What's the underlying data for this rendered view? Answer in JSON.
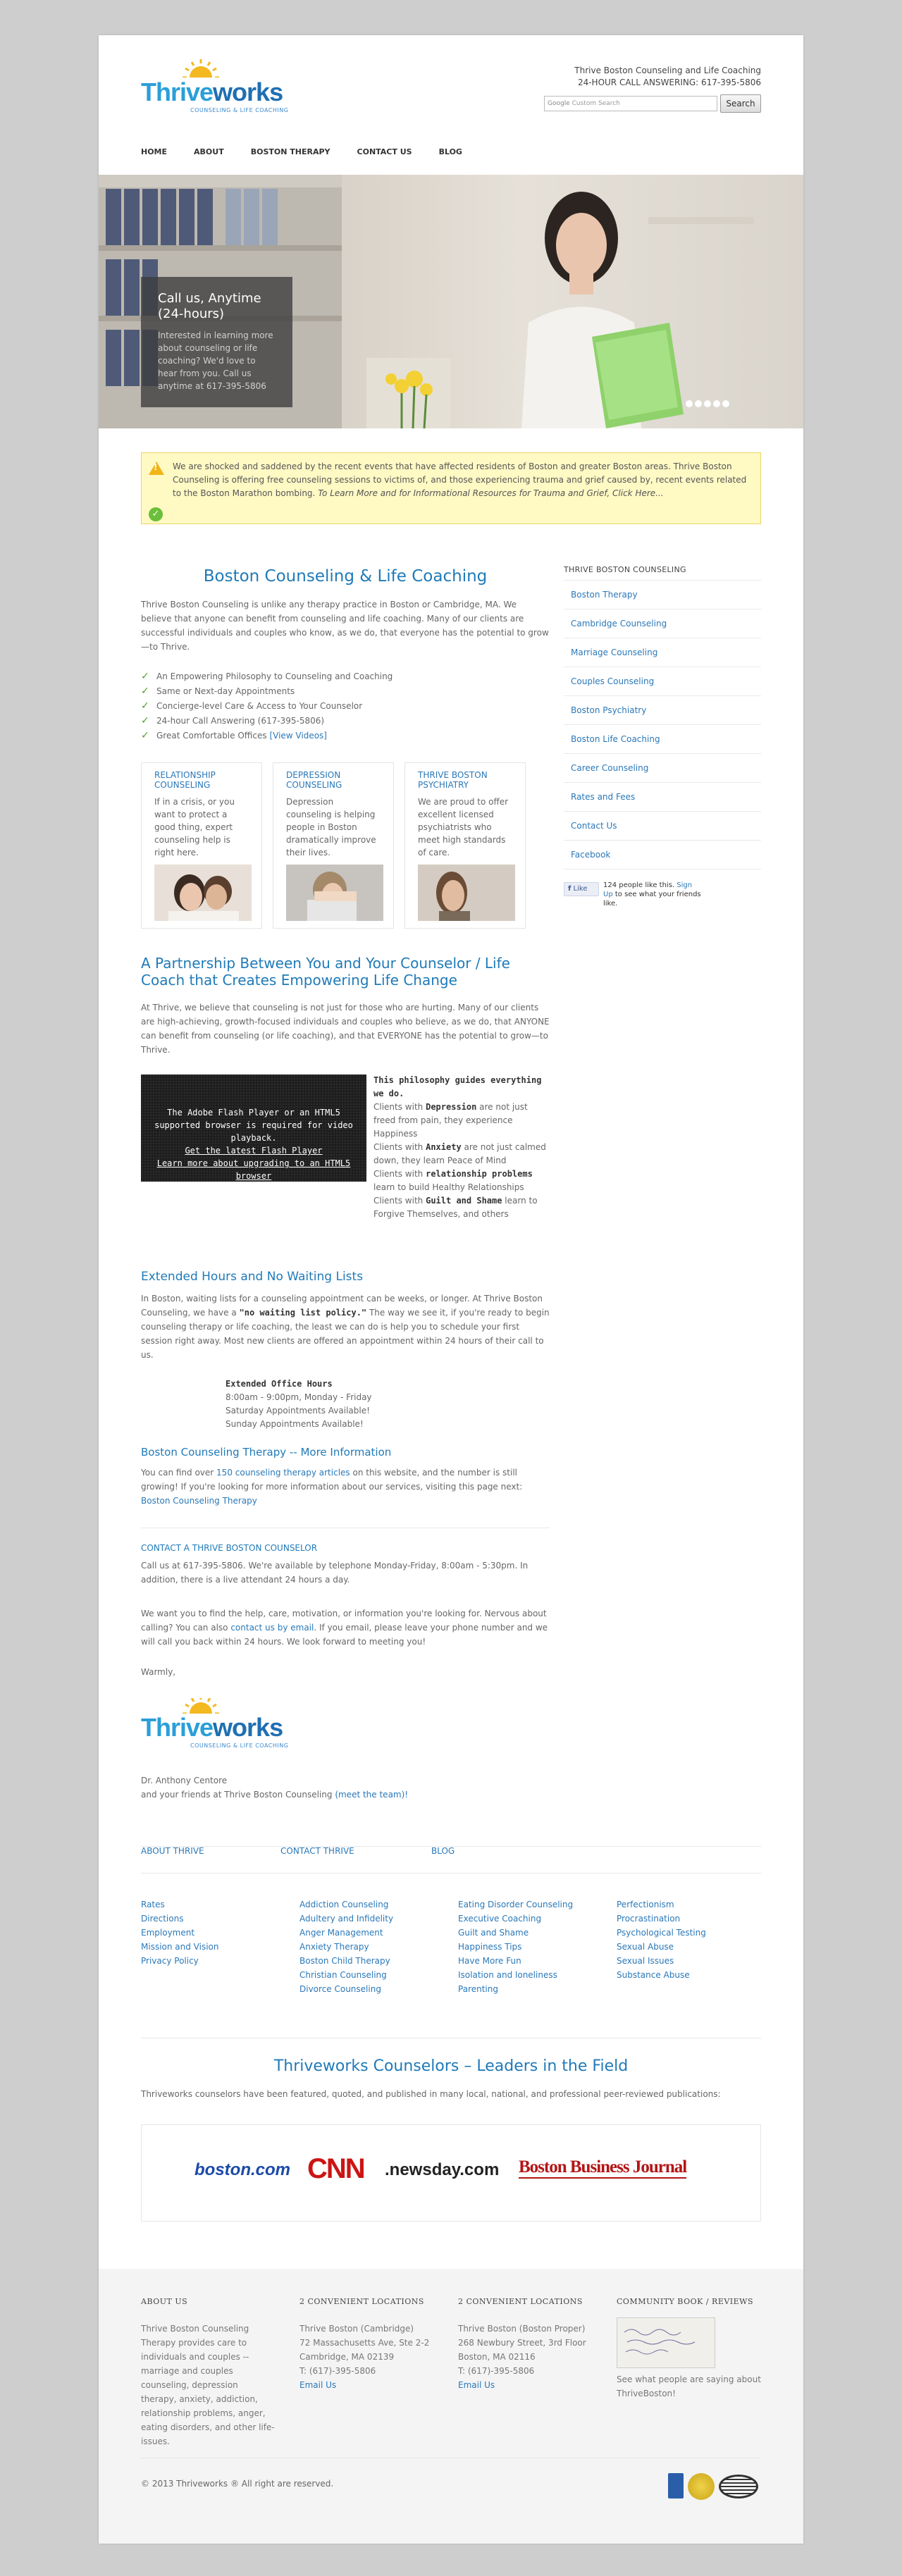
{
  "header": {
    "logo_main": "Thriveworks",
    "logo_tagline": "COUNSELING & LIFE COACHING",
    "contact_line1": "Thrive Boston Counseling and Life Coaching",
    "contact_line2": "24-HOUR CALL ANSWERING: 617-395-5806",
    "search_placeholder": "Custom Search",
    "search_brand": "Google",
    "search_button": "Search"
  },
  "nav": [
    "HOME",
    "ABOUT",
    "BOSTON THERAPY",
    "CONTACT US",
    "BLOG"
  ],
  "hero": {
    "title": "Call us, Anytime (24-hours)",
    "text": "Interested in learning more about counseling or life coaching? We'd love to hear from you. Call us anytime at 617-395-5806",
    "slides": 5
  },
  "alert": {
    "text": "We are shocked and saddened by the recent events that have affected residents of Boston and greater Boston areas. Thrive Boston Counseling is offering free counseling sessions to victims of, and those experiencing trauma and grief caused by, recent events related to the Boston Marathon bombing.",
    "link": "To Learn More and for Informational Resources for Trauma and Grief, Click Here..."
  },
  "main": {
    "title": "Boston Counseling & Life Coaching",
    "intro": "Thrive Boston Counseling is unlike any therapy practice in Boston or Cambridge, MA. We believe that anyone can benefit from counseling and life coaching. Many of our clients are successful individuals and couples who know, as we do, that everyone has the potential to grow—to Thrive.",
    "checks": [
      "An Empowering Philosophy to Counseling and Coaching",
      "Same or Next-day Appointments",
      "Concierge-level Care & Access to Your Counselor",
      "24-hour Call Answering (617-395-5806)",
      "Great Comfortable Offices"
    ],
    "checks_link": "[View Videos]",
    "services": [
      {
        "title": "RELATIONSHIP COUNSELING",
        "text": "If in a crisis, or you want to protect a good thing, expert counseling help is right here."
      },
      {
        "title": "DEPRESSION COUNSELING",
        "text": "Depression counseling is helping people in Boston dramatically improve their lives."
      },
      {
        "title": "THRIVE BOSTON PSYCHIATRY",
        "text": "We are proud to offer excellent licensed psychiatrists who meet high standards of care."
      }
    ],
    "partnership_title": "A Partnership Between You and Your Counselor / Life Coach that Creates Empowering Life Change",
    "partnership_text": "At Thrive, we believe that counseling is not just for those who are hurting. Many of our clients are high-achieving, growth-focused individuals and couples who believe, as we do, that ANYONE can benefit from counseling (or life coaching), and that EVERYONE has the potential to grow—to Thrive.",
    "flash_line1": "The Adobe Flash Player or an HTML5 supported browser is required for video playback.",
    "flash_link1": "Get the latest Flash Player",
    "flash_link2": "Learn more about upgrading to an HTML5 browser",
    "philosophy_head": "This philosophy guides everything we do.",
    "phil": [
      {
        "a": "Clients with ",
        "b": "Depression",
        "c": " are not just freed from pain, they experience Happiness"
      },
      {
        "a": "Clients with ",
        "b": "Anxiety",
        "c": " are not just calmed down, they learn Peace of Mind"
      },
      {
        "a": "Clients with ",
        "b": "relationship problems",
        "c": " learn to build Healthy Relationships"
      },
      {
        "a": "Clients with ",
        "b": "Guilt and Shame",
        "c": " learn to Forgive Themselves, and others"
      }
    ],
    "hours_title": "Extended Hours and No Waiting Lists",
    "hours_text_a": "In Boston, waiting lists for a counseling appointment can be weeks, or longer. At Thrive Boston Counseling, we have a ",
    "hours_text_b": "\"no waiting list policy.\"",
    "hours_text_c": " The way we see it, if you're ready to begin counseling therapy or life coaching, the least we can do is help you to schedule your first session right away. Most new clients are offered an appointment within 24 hours of their call to us.",
    "office_hours_head": "Extended Office Hours",
    "office_hours": [
      "8:00am - 9:00pm, Monday - Friday",
      "Saturday Appointments Available!",
      "Sunday Appointments Available!"
    ],
    "more_title": "Boston Counseling Therapy -- More Information",
    "more_a": "You can find over ",
    "more_link": "150 counseling therapy articles",
    "more_b": " on this website, and the number is still growing! If you're looking for more information about our services, visiting this page next: ",
    "more_link2": "Boston Counseling Therapy",
    "contact_title": "CONTACT A THRIVE BOSTON COUNSELOR",
    "contact_p1": "Call us at 617-395-5806. We're available by telephone Monday-Friday, 8:00am - 5:30pm. In addition, there is a live attendant 24 hours a day.",
    "contact_p2a": "We want you to find the help, care, motivation, or information you're looking for. Nervous about calling? You can also ",
    "contact_p2link": "contact us by email",
    "contact_p2b": ". If you email, please leave your phone number and we will call you back within 24 hours. We look forward to meeting you!",
    "warmly": "Warmly,",
    "sig_name": "Dr. Anthony Centore",
    "sig_line": "and your friends at Thrive Boston Counseling",
    "sig_link": "(meet the team)!"
  },
  "sidebar": {
    "title": "THRIVE BOSTON COUNSELING",
    "items": [
      "Boston Therapy",
      "Cambridge Counseling",
      "Marriage Counseling",
      "Couples Counseling",
      "Boston Psychiatry",
      "Boston Life Coaching",
      "Career Counseling",
      "Rates and Fees",
      "Contact Us",
      "Facebook"
    ],
    "like_button": "Like",
    "like_text1": "124 people like this.",
    "like_signup": "Sign Up",
    "like_text2": " to see what your friends like."
  },
  "bottom_nav": [
    "ABOUT THRIVE",
    "CONTACT THRIVE",
    "BLOG"
  ],
  "link_cols": [
    [
      "Rates",
      "Directions",
      "Employment",
      "Mission and Vision",
      "Privacy Policy"
    ],
    [
      "Addiction Counseling",
      "Adultery and Infidelity",
      "Anger Management",
      "Anxiety Therapy",
      "Boston Child Therapy",
      "Christian Counseling",
      "Divorce Counseling"
    ],
    [
      "Eating Disorder Counseling",
      "Executive Coaching",
      "Guilt and Shame",
      "Happiness Tips",
      "Have More Fun",
      "Isolation and loneliness",
      "Parenting"
    ],
    [
      "Perfectionism",
      "Procrastination",
      "Psychological Testing",
      "Sexual Abuse",
      "Sexual Issues",
      "Substance Abuse"
    ]
  ],
  "leaders": {
    "title": "Thriveworks Counselors – Leaders in the Field",
    "text": "Thriveworks counselors have been featured, quoted, and published in many local, national, and professional peer-reviewed publications:",
    "logos": [
      "boston.com",
      "CNN",
      ".newsday.com",
      "Boston Business Journal"
    ]
  },
  "footer": {
    "about_title": "ABOUT US",
    "about_text": "Thrive Boston Counseling Therapy provides care to individuals and couples -- marriage and couples counseling, depression therapy, anxiety, addiction, relationship problems, anger, eating disorders, and other life-issues.",
    "loc_title": "2 CONVENIENT LOCATIONS",
    "loc1": [
      "Thrive Boston (Cambridge)",
      "72 Massachusetts Ave, Ste 2-2",
      "Cambridge, MA 02139",
      "T: (617)-395-5806"
    ],
    "loc2": [
      "Thrive Boston (Boston Proper)",
      "268 Newbury Street, 3rd Floor",
      "Boston, MA 02116",
      "T: (617)-395-5806"
    ],
    "email": "Email Us",
    "book_title": "COMMUNITY BOOK / REVIEWS",
    "book_text": "See what people are saying about ThriveBoston!",
    "copyright": "© 2013 Thriveworks ® All right are reserved."
  },
  "colors": {
    "accent": "#1f7ab8",
    "check": "#4fa12f",
    "alert_bg": "#fff9c4",
    "footer_bg": "#f4f4f4"
  }
}
